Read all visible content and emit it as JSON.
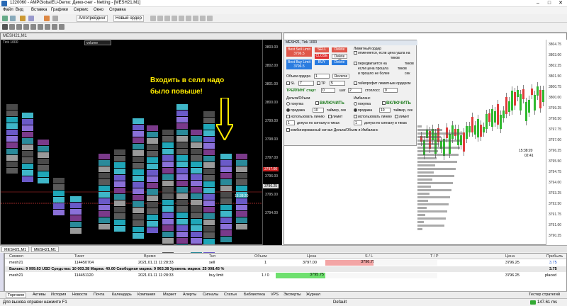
{
  "window": {
    "title": "1220060 - AMPGlobalEU-Demo: Демо-счет - Netting - [MESH21,M1]",
    "min": "–",
    "max": "□",
    "close": "✕"
  },
  "menu": [
    "Файл",
    "Вид",
    "Вставка",
    "Графики",
    "Сервис",
    "Окно",
    "Справка"
  ],
  "toolbar": {
    "algo": "Алготрейдинг",
    "new_order": "Новый ордер"
  },
  "chart1": {
    "title": "MESH21,M1",
    "tf_label": "Tick 1000",
    "volume_select": "volume",
    "prices": [
      "3803.00",
      "3802.00",
      "3801.00",
      "3800.00",
      "3799.00",
      "3798.00",
      "3797.00",
      "3796.00",
      "3795.00",
      "3794.00"
    ],
    "price_marker_sell": "3797.00",
    "price_marker_bid": "3796.25",
    "time_label": "15:38:20"
  },
  "annotation": "Входить в селл надо было повыше!",
  "panel": {
    "title": "MESH21, Tick 1000",
    "best_sell": "Best Sell Limit 3796.5",
    "sell": "SELL",
    "delete1": "Delete",
    "close": "CLOSE",
    "delete_all": "Delete all",
    "best_buy": "Best Buy Limit 3796.5",
    "buy": "BUY",
    "delete2": "Delete",
    "limit_order": "Лимитный ордер",
    "cancel_if_away": "отменяется, если цена ушла на",
    "ticks1": "тиков",
    "move_on": "передвигается на",
    "ticks2": "тиков",
    "if_price_away": "если цена прошла",
    "ticks3": "тиков",
    "not_more": "и прошло не более",
    "sec": "сек",
    "order_volume": "Объем ордера",
    "order_volume_val": "1",
    "reverse": "Reverse",
    "sl": "SL",
    "sl_val": "7",
    "tp": "TP",
    "tp_val": "5",
    "trailing": "ТРЕЙЛИНГ старт",
    "trail_start": "0",
    "step": "шаг",
    "step_val": "2",
    "stop_loss": "стоплосс",
    "stop_val": "0",
    "take_profit_limit": "тейкпрофит лимитным ордером",
    "delta_vol": "Дельта/Объем",
    "imbalance": "Имбаланс",
    "buy_radio": "покупка",
    "sell_radio": "продажа",
    "enable": "ВКЛЮЧИТЬ",
    "timer": "таймер, сек",
    "timer_val": "10",
    "use_line": "использовать линию",
    "limit": "лимит",
    "tolerance": "допуск по сигналу в тиках",
    "tol_val": "1",
    "combined": "комбинированный сигнал Дельта/Объем и Имбаланс"
  },
  "chart2": {
    "prices": [
      "3804.75",
      "3803.00",
      "3802.25",
      "3801.50",
      "3800.75",
      "3800.00",
      "3799.25",
      "3798.50",
      "3797.75",
      "3797.00",
      "3796.25",
      "3795.50",
      "3794.75",
      "3794.00",
      "3793.25",
      "3792.50",
      "3791.75",
      "3791.00",
      "3790.25"
    ],
    "time": "15:38:20",
    "time2": "02:41"
  },
  "chart_tabs": [
    "MESH21,M1",
    "MESH21,M1"
  ],
  "terminal": {
    "headers": [
      "Символ",
      "Тикет",
      "Время",
      "Тип",
      "Объем",
      "Цена",
      "S / L",
      "T / P",
      "Цена",
      "Прибыль"
    ],
    "rows": [
      {
        "symbol": "mesh21",
        "ticket": "114450704",
        "time": "2021.01.11 11:28:33",
        "type": "sell",
        "volume": "1",
        "price": "3797.00",
        "sl": "3796.75",
        "tp": "",
        "cur": "3796.25",
        "profit": "3.75"
      },
      {
        "balance": "Баланс: 9 999.63 USD  Средства: 10 003.38  Маржа: 40.00  Свободная маржа: 9 963.38  Уровень маржи: 25 008.45 %",
        "profit": "3.75"
      },
      {
        "symbol": "mesh21",
        "ticket": "114451120",
        "time": "2021.01.11 11:28:33",
        "type": "buy limit",
        "volume": "1 / 0",
        "price": "3795.75",
        "sl": "",
        "tp": "",
        "cur": "3796.25",
        "profit": "placed"
      }
    ]
  },
  "term_tabs": [
    "Торговля",
    "Активы",
    "История",
    "Новости",
    "Почта",
    "Календарь",
    "Компания",
    "Маркет",
    "Алерты",
    "Сигналы",
    "Статьи",
    "Библиотека",
    "VPS",
    "Эксперты",
    "Журнал"
  ],
  "strategy_tester": "Тестер стратегий",
  "status": {
    "help": "Для вызова справки нажмите F1",
    "profile": "Default",
    "ping": "147.61 ms"
  }
}
